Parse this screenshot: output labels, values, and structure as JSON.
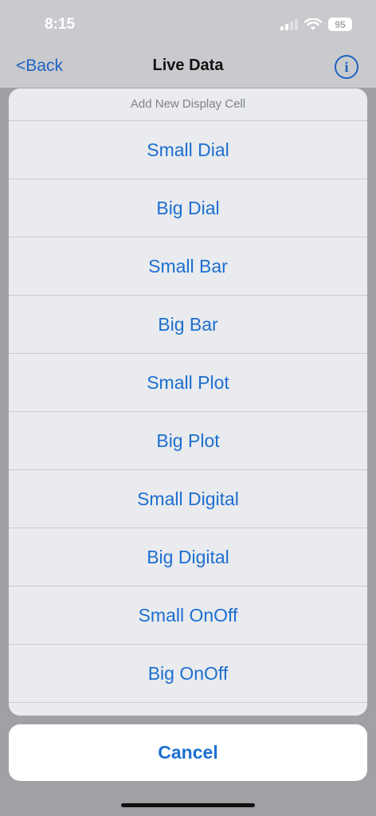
{
  "status": {
    "time": "8:15",
    "battery": "95"
  },
  "nav": {
    "back_label": "<Back",
    "title": "Live Data",
    "info_glyph": "i"
  },
  "sheet": {
    "title": "Add New Display Cell",
    "options": [
      "Small Dial",
      "Big Dial",
      "Small Bar",
      "Big Bar",
      "Small Plot",
      "Big Plot",
      "Small Digital",
      "Big Digital",
      "Small OnOff",
      "Big OnOff"
    ],
    "cancel_label": "Cancel"
  },
  "colors": {
    "accent": "#1d6fd0",
    "sheet_bg": "#e9ebee",
    "dim_bg": "#a7a9ad"
  }
}
